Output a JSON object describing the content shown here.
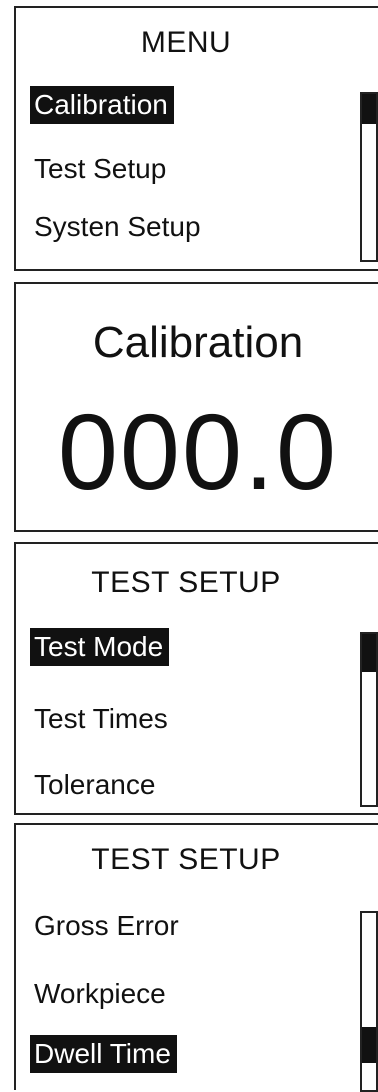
{
  "menu_screen": {
    "title": "MENU",
    "items": [
      "Calibration",
      "Test Setup",
      "Systen Setup"
    ],
    "selected_index": 0,
    "scroll_position": "top"
  },
  "calibration_screen": {
    "title": "Calibration",
    "value": "000.0"
  },
  "test_setup_screen_1": {
    "title": "TEST SETUP",
    "items": [
      "Test Mode",
      "Test Times",
      "Tolerance"
    ],
    "selected_index": 0,
    "scroll_position": "top"
  },
  "test_setup_screen_2": {
    "title": "TEST SETUP",
    "items": [
      "Gross Error",
      "Workpiece",
      "Dwell Time"
    ],
    "selected_index": 2,
    "scroll_position": "bottom"
  },
  "colors": {
    "highlight_background": "#111111",
    "highlight_text": "#ffffff",
    "text": "#111111"
  }
}
